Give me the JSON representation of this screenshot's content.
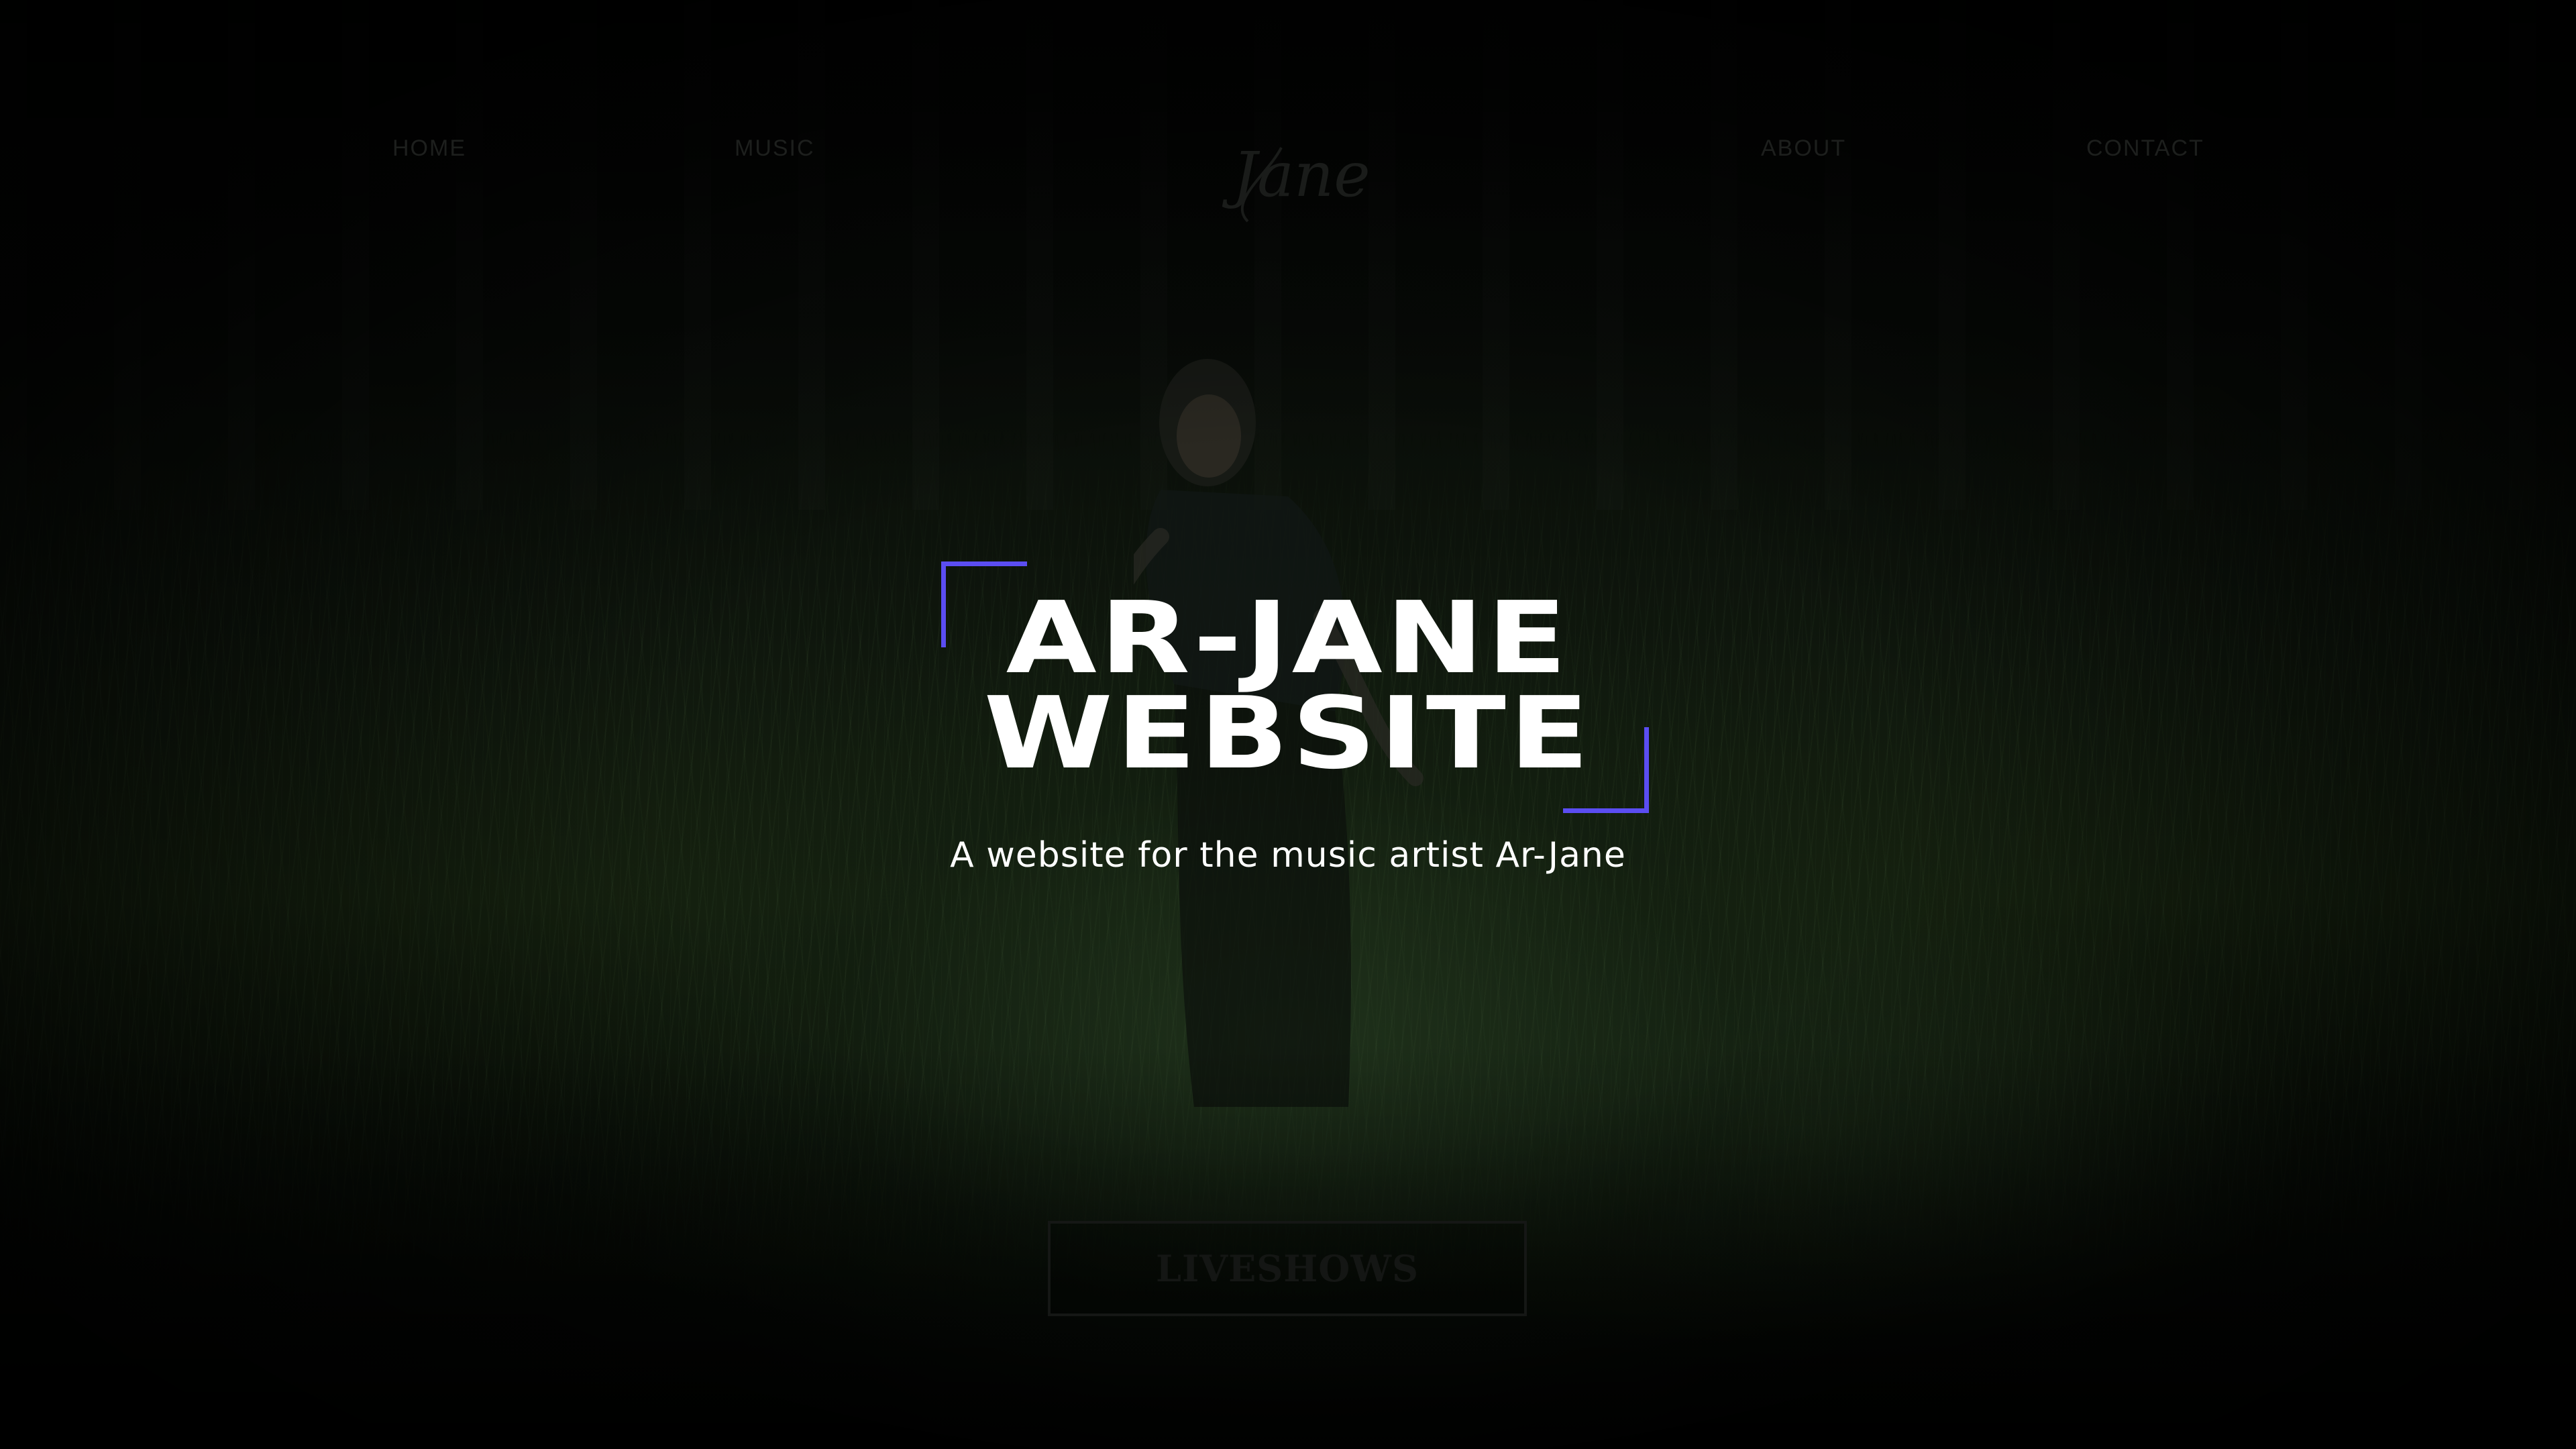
{
  "nav": {
    "home_label": "HOME",
    "music_label": "MUSIC",
    "about_label": "ABOUT",
    "contact_label": "CONTACT",
    "logo_text": "Jane"
  },
  "hero": {
    "title_line1": "AR-JANE",
    "title_line2": "WEBSITE",
    "subtitle": "A website for the music artist Ar-Jane",
    "accent_color": "#5b4df2"
  },
  "cta": {
    "label": "LIVESHOWS"
  }
}
